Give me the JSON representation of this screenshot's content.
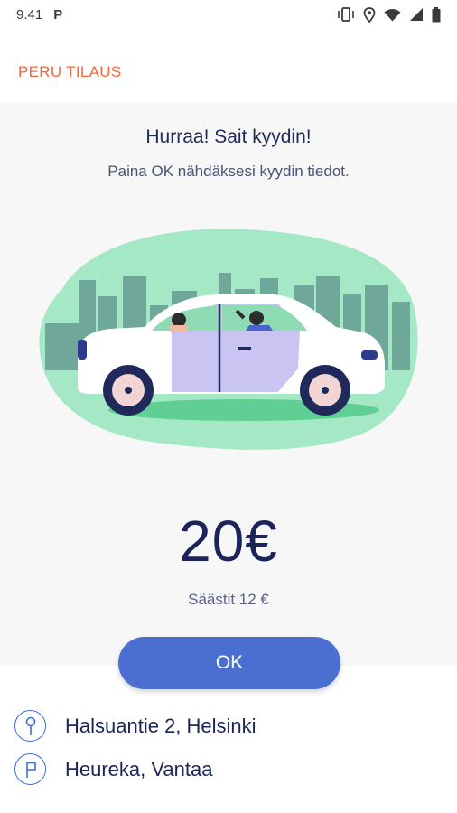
{
  "status_bar": {
    "time": "9.41",
    "app_indicator": "P",
    "icons": [
      "vibrate-icon",
      "location-icon",
      "wifi-icon",
      "signal-icon",
      "battery-icon"
    ]
  },
  "header": {
    "cancel_label": "PERU TILAUS"
  },
  "confirmation": {
    "title": "Hurraa! Sait kyydin!",
    "subtitle": "Paina OK nähdäksesi kyydin tiedot.",
    "price": "20€",
    "savings": "Säästit 12 €"
  },
  "actions": {
    "ok_label": "OK"
  },
  "route": {
    "from": "Halsuantie 2, Helsinki",
    "to": "Heureka, Vantaa"
  },
  "colors": {
    "accent_orange": "#f2673a",
    "button_blue": "#4a6fd0",
    "text_navy": "#1b2458",
    "illustration_green": "#a5e8c6"
  }
}
